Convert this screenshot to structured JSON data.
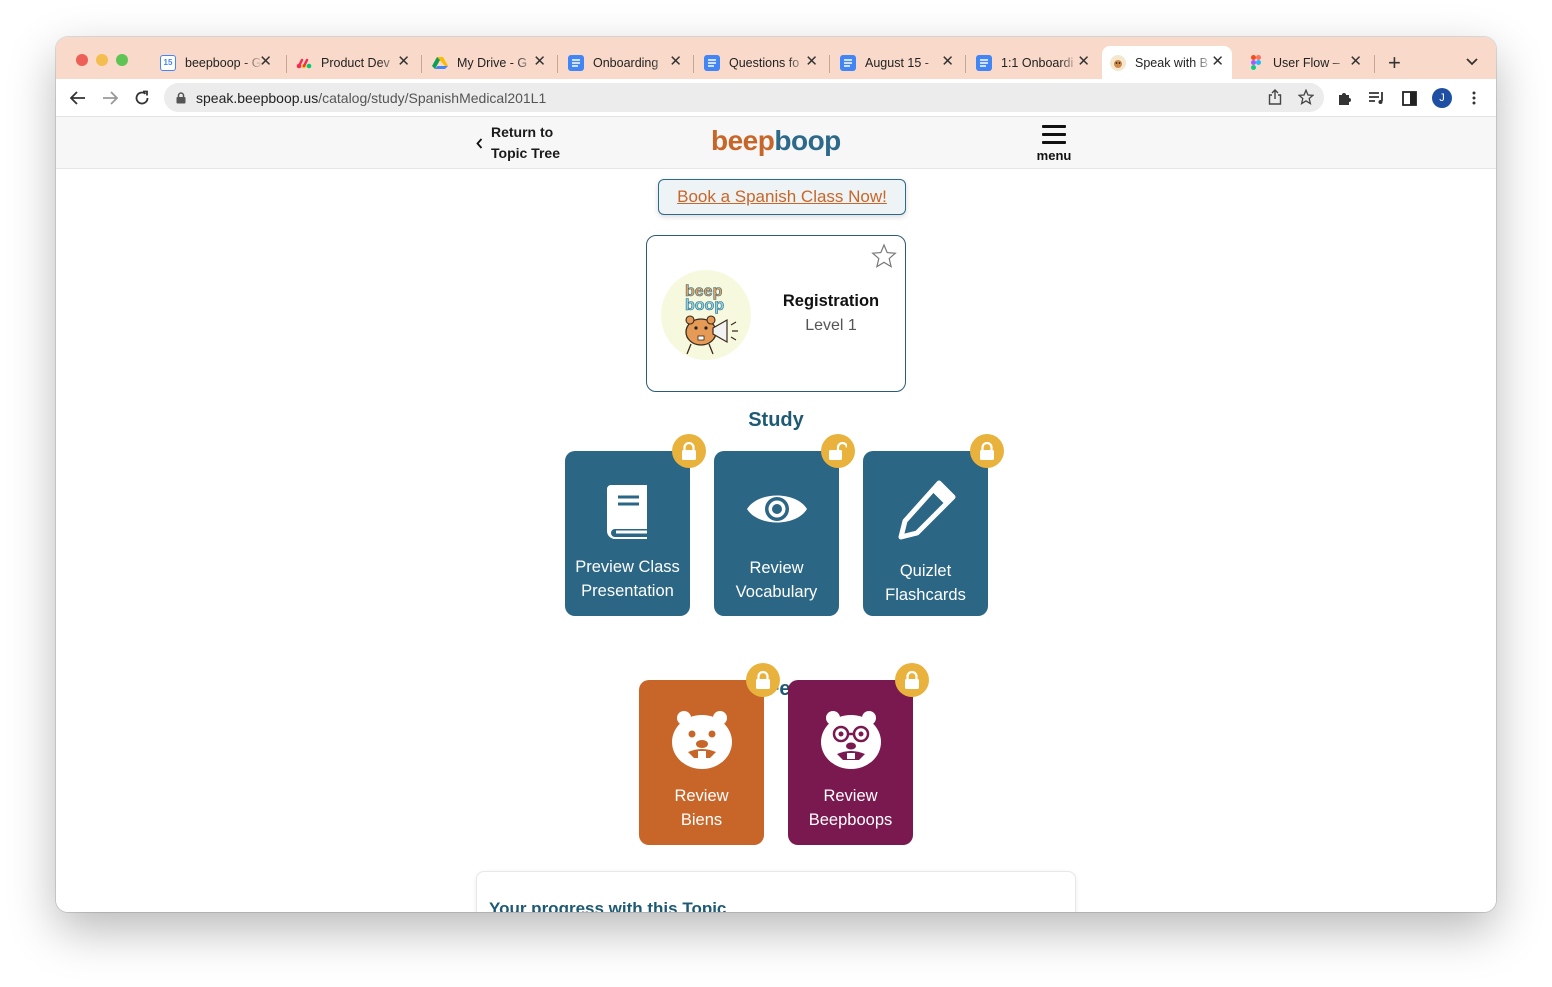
{
  "browser": {
    "tabs": [
      {
        "title": "beepboop - G",
        "icon": "calendar-icon",
        "active": false
      },
      {
        "title": "Product Dev",
        "icon": "monday-icon",
        "active": false
      },
      {
        "title": "My Drive - G",
        "icon": "drive-icon",
        "active": false
      },
      {
        "title": "Onboarding",
        "icon": "docs-icon",
        "active": false
      },
      {
        "title": "Questions fo",
        "icon": "docs-icon",
        "active": false
      },
      {
        "title": "August 15 - ",
        "icon": "docs-icon",
        "active": false
      },
      {
        "title": "1:1 Onboardi",
        "icon": "docs-icon",
        "active": false
      },
      {
        "title": "Speak with B",
        "icon": "beepboop-icon",
        "active": true
      },
      {
        "title": "User Flow – ",
        "icon": "figma-icon",
        "active": false
      }
    ],
    "url_host": "speak.beepboop.us",
    "url_path": "/catalog/study/SpanishMedical201L1",
    "profile_initial": "J"
  },
  "site": {
    "back_line1": "Return to",
    "back_line2": "Topic Tree",
    "logo_part1": "beep",
    "logo_part2": "boop",
    "menu_label": "menu",
    "book_cta": "Book a Spanish Class Now!"
  },
  "topic": {
    "title": "Registration",
    "level": "Level 1",
    "favorited": false
  },
  "study": {
    "heading": "Study",
    "tiles": [
      {
        "line1": "Preview Class",
        "line2": "Presentation",
        "icon": "book-icon",
        "lock": "locked"
      },
      {
        "line1": "Review",
        "line2": "Vocabulary",
        "icon": "eye-icon",
        "lock": "unlocked"
      },
      {
        "line1": "Quizlet",
        "line2": "Flashcards",
        "icon": "pencil-icon",
        "lock": "locked"
      }
    ]
  },
  "feedback": {
    "heading": "Review Feedback",
    "tiles": [
      {
        "line1": "Review",
        "line2": "Biens",
        "icon": "beaver-icon",
        "lock": "locked"
      },
      {
        "line1": "Review",
        "line2": "Beepboops",
        "icon": "beaver-glasses-icon",
        "lock": "locked"
      }
    ]
  },
  "progress": {
    "title": "Your progress with this Topic"
  },
  "colors": {
    "tabstrip": "#f9d9c9",
    "tile_blue": "#2b6684",
    "tile_orange": "#c8662a",
    "tile_purple": "#7a1850",
    "lock_yellow": "#e8b23c",
    "heading_blue": "#1f5a74"
  }
}
